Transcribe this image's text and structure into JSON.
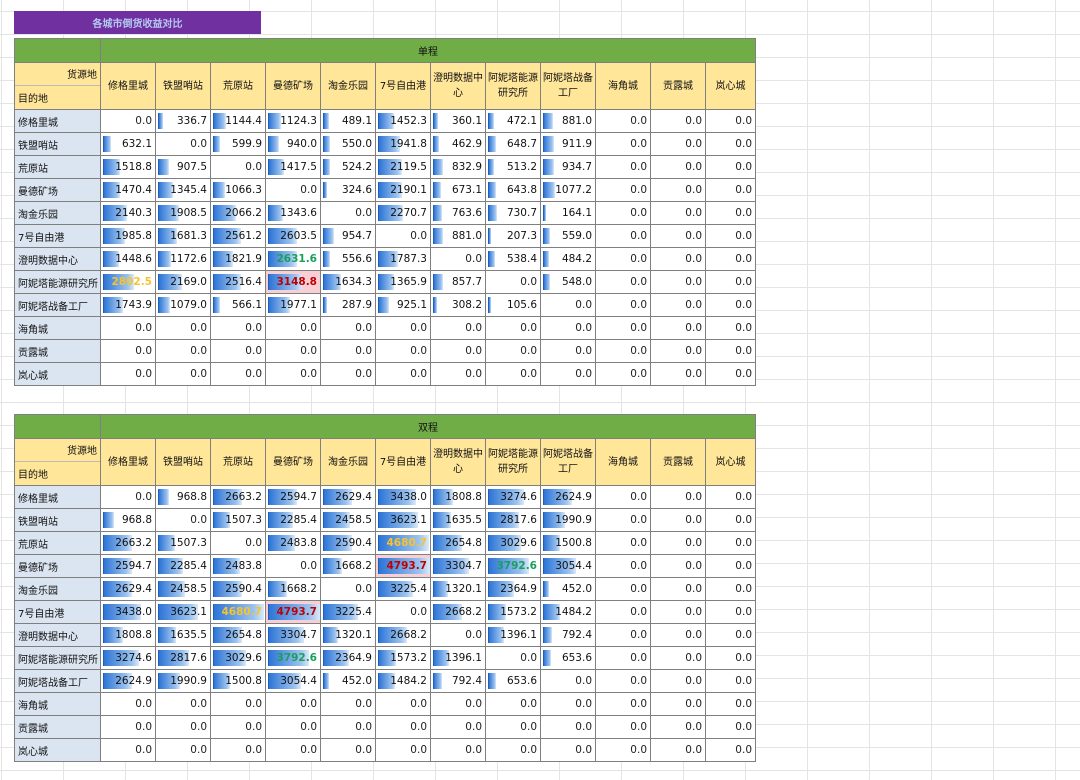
{
  "title": "各城市倒货收益对比",
  "corner": {
    "source": "货源地",
    "destination": "目的地"
  },
  "columns": [
    "修格里城",
    "铁盟哨站",
    "荒原站",
    "曼德矿场",
    "淘金乐园",
    "7号自由港",
    "澄明数据中心",
    "阿妮塔能源研究所",
    "阿妮塔战备工厂",
    "海角城",
    "贡露城",
    "岚心城"
  ],
  "max_value": 4793.7,
  "tables": [
    {
      "group_label": "单程",
      "rows": [
        {
          "label": "修格里城",
          "values": [
            "0.0",
            "336.7",
            "1144.4",
            "1124.3",
            "489.1",
            "1452.3",
            "360.1",
            "472.1",
            "881.0",
            "0.0",
            "0.0",
            "0.0"
          ]
        },
        {
          "label": "铁盟哨站",
          "values": [
            "632.1",
            "0.0",
            "599.9",
            "940.0",
            "550.0",
            "1941.8",
            "462.9",
            "648.7",
            "911.9",
            "0.0",
            "0.0",
            "0.0"
          ]
        },
        {
          "label": "荒原站",
          "values": [
            "1518.8",
            "907.5",
            "0.0",
            "1417.5",
            "524.2",
            "2119.5",
            "832.9",
            "513.2",
            "934.7",
            "0.0",
            "0.0",
            "0.0"
          ]
        },
        {
          "label": "曼德矿场",
          "values": [
            "1470.4",
            "1345.4",
            "1066.3",
            "0.0",
            "324.6",
            "2190.1",
            "673.1",
            "643.8",
            "1077.2",
            "0.0",
            "0.0",
            "0.0"
          ]
        },
        {
          "label": "淘金乐园",
          "values": [
            "2140.3",
            "1908.5",
            "2066.2",
            "1343.6",
            "0.0",
            "2270.7",
            "763.6",
            "730.7",
            "164.1",
            "0.0",
            "0.0",
            "0.0"
          ]
        },
        {
          "label": "7号自由港",
          "values": [
            "1985.8",
            "1681.3",
            "2561.2",
            "2603.5",
            "954.7",
            "0.0",
            "881.0",
            "207.3",
            "559.0",
            "0.0",
            "0.0",
            "0.0"
          ]
        },
        {
          "label": "澄明数据中心",
          "values": [
            "1448.6",
            "1172.6",
            "1821.9",
            "2631.6",
            "556.6",
            "1787.3",
            "0.0",
            "538.4",
            "484.2",
            "0.0",
            "0.0",
            "0.0"
          ]
        },
        {
          "label": "阿妮塔能源研究所",
          "values": [
            "2802.5",
            "2169.0",
            "2516.4",
            "3148.8",
            "1634.3",
            "1365.9",
            "857.7",
            "0.0",
            "548.0",
            "0.0",
            "0.0",
            "0.0"
          ]
        },
        {
          "label": "阿妮塔战备工厂",
          "values": [
            "1743.9",
            "1079.0",
            "566.1",
            "1977.1",
            "287.9",
            "925.1",
            "308.2",
            "105.6",
            "0.0",
            "0.0",
            "0.0",
            "0.0"
          ]
        },
        {
          "label": "海角城",
          "values": [
            "0.0",
            "0.0",
            "0.0",
            "0.0",
            "0.0",
            "0.0",
            "0.0",
            "0.0",
            "0.0",
            "0.0",
            "0.0",
            "0.0"
          ]
        },
        {
          "label": "贡露城",
          "values": [
            "0.0",
            "0.0",
            "0.0",
            "0.0",
            "0.0",
            "0.0",
            "0.0",
            "0.0",
            "0.0",
            "0.0",
            "0.0",
            "0.0"
          ]
        },
        {
          "label": "岚心城",
          "values": [
            "0.0",
            "0.0",
            "0.0",
            "0.0",
            "0.0",
            "0.0",
            "0.0",
            "0.0",
            "0.0",
            "0.0",
            "0.0",
            "0.0"
          ]
        }
      ],
      "highlights": [
        {
          "row": 6,
          "col": 3,
          "style": "green"
        },
        {
          "row": 7,
          "col": 0,
          "style": "yellow"
        },
        {
          "row": 7,
          "col": 3,
          "style": "red"
        }
      ]
    },
    {
      "group_label": "双程",
      "rows": [
        {
          "label": "修格里城",
          "values": [
            "0.0",
            "968.8",
            "2663.2",
            "2594.7",
            "2629.4",
            "3438.0",
            "1808.8",
            "3274.6",
            "2624.9",
            "0.0",
            "0.0",
            "0.0"
          ]
        },
        {
          "label": "铁盟哨站",
          "values": [
            "968.8",
            "0.0",
            "1507.3",
            "2285.4",
            "2458.5",
            "3623.1",
            "1635.5",
            "2817.6",
            "1990.9",
            "0.0",
            "0.0",
            "0.0"
          ]
        },
        {
          "label": "荒原站",
          "values": [
            "2663.2",
            "1507.3",
            "0.0",
            "2483.8",
            "2590.4",
            "4680.7",
            "2654.8",
            "3029.6",
            "1500.8",
            "0.0",
            "0.0",
            "0.0"
          ]
        },
        {
          "label": "曼德矿场",
          "values": [
            "2594.7",
            "2285.4",
            "2483.8",
            "0.0",
            "1668.2",
            "4793.7",
            "3304.7",
            "3792.6",
            "3054.4",
            "0.0",
            "0.0",
            "0.0"
          ]
        },
        {
          "label": "淘金乐园",
          "values": [
            "2629.4",
            "2458.5",
            "2590.4",
            "1668.2",
            "0.0",
            "3225.4",
            "1320.1",
            "2364.9",
            "452.0",
            "0.0",
            "0.0",
            "0.0"
          ]
        },
        {
          "label": "7号自由港",
          "values": [
            "3438.0",
            "3623.1",
            "4680.7",
            "4793.7",
            "3225.4",
            "0.0",
            "2668.2",
            "1573.2",
            "1484.2",
            "0.0",
            "0.0",
            "0.0"
          ]
        },
        {
          "label": "澄明数据中心",
          "values": [
            "1808.8",
            "1635.5",
            "2654.8",
            "3304.7",
            "1320.1",
            "2668.2",
            "0.0",
            "1396.1",
            "792.4",
            "0.0",
            "0.0",
            "0.0"
          ]
        },
        {
          "label": "阿妮塔能源研究所",
          "values": [
            "3274.6",
            "2817.6",
            "3029.6",
            "3792.6",
            "2364.9",
            "1573.2",
            "1396.1",
            "0.0",
            "653.6",
            "0.0",
            "0.0",
            "0.0"
          ]
        },
        {
          "label": "阿妮塔战备工厂",
          "values": [
            "2624.9",
            "1990.9",
            "1500.8",
            "3054.4",
            "452.0",
            "1484.2",
            "792.4",
            "653.6",
            "0.0",
            "0.0",
            "0.0",
            "0.0"
          ]
        },
        {
          "label": "海角城",
          "values": [
            "0.0",
            "0.0",
            "0.0",
            "0.0",
            "0.0",
            "0.0",
            "0.0",
            "0.0",
            "0.0",
            "0.0",
            "0.0",
            "0.0"
          ]
        },
        {
          "label": "贡露城",
          "values": [
            "0.0",
            "0.0",
            "0.0",
            "0.0",
            "0.0",
            "0.0",
            "0.0",
            "0.0",
            "0.0",
            "0.0",
            "0.0",
            "0.0"
          ]
        },
        {
          "label": "岚心城",
          "values": [
            "0.0",
            "0.0",
            "0.0",
            "0.0",
            "0.0",
            "0.0",
            "0.0",
            "0.0",
            "0.0",
            "0.0",
            "0.0",
            "0.0"
          ]
        }
      ],
      "highlights": [
        {
          "row": 2,
          "col": 5,
          "style": "yellow"
        },
        {
          "row": 3,
          "col": 5,
          "style": "red"
        },
        {
          "row": 3,
          "col": 7,
          "style": "green"
        },
        {
          "row": 5,
          "col": 2,
          "style": "yellow"
        },
        {
          "row": 5,
          "col": 3,
          "style": "red"
        },
        {
          "row": 7,
          "col": 3,
          "style": "green"
        }
      ]
    }
  ]
}
